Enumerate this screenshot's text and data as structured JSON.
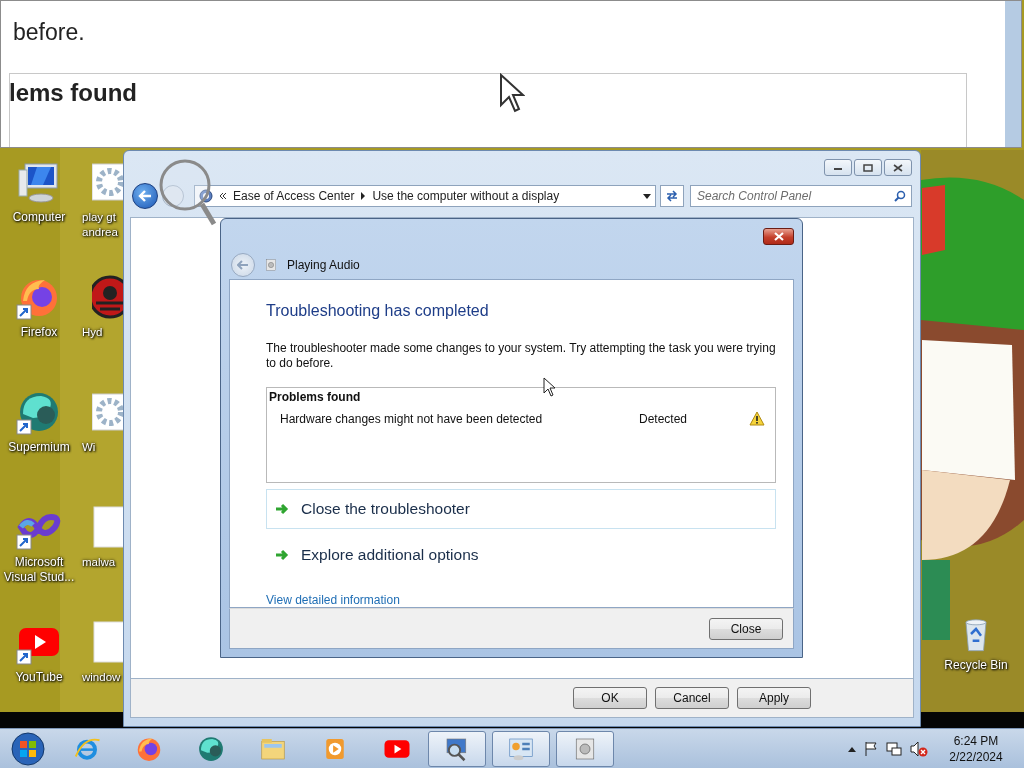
{
  "magnifier": {
    "texts": [
      "before.",
      "lems found"
    ]
  },
  "desktop_icons": [
    {
      "kind": "computer",
      "lines": [
        "Computer"
      ],
      "shortcut": false
    },
    {
      "kind": "firefox",
      "lines": [
        "Firefox"
      ],
      "shortcut": true
    },
    {
      "kind": "supermium",
      "lines": [
        "Supermium"
      ],
      "shortcut": true
    },
    {
      "kind": "visualstudio",
      "lines": [
        "Microsoft",
        "Visual Stud..."
      ],
      "shortcut": true
    },
    {
      "kind": "youtube",
      "lines": [
        "YouTube"
      ],
      "shortcut": true
    }
  ],
  "desktop_icons_2": [
    {
      "kind": "gear",
      "lines": [
        "play gt",
        "andrea"
      ]
    },
    {
      "kind": "emblem",
      "lines": [
        "Hyd"
      ]
    },
    {
      "kind": "gear",
      "lines": [
        "Wi"
      ]
    },
    {
      "kind": "document",
      "lines": [
        "malwa"
      ]
    },
    {
      "kind": "document",
      "lines": [
        "window"
      ]
    }
  ],
  "recycle_bin": {
    "label": "Recycle Bin"
  },
  "control_panel": {
    "breadcrumbs": [
      "Ease of Access Center",
      "Use the computer without a display"
    ],
    "search": {
      "placeholder": "Search Control Panel"
    },
    "buttons": [
      "OK",
      "Cancel",
      "Apply"
    ]
  },
  "troubleshooter": {
    "title": "Playing Audio",
    "heading": "Troubleshooting has completed",
    "message": "The troubleshooter made some changes to your system. Try attempting the task you were trying to do before.",
    "problems": {
      "title": "Problems found",
      "rows": [
        {
          "problem": "Hardware changes might not have been detected",
          "status": "Detected",
          "kind": "warning"
        }
      ]
    },
    "options": [
      {
        "label": "Close the troubleshooter",
        "selected": true
      },
      {
        "label": "Explore additional options",
        "selected": false
      }
    ],
    "link": "View detailed information",
    "close_button": "Close"
  },
  "taskbar": {
    "pinned": [
      {
        "kind": "ie"
      },
      {
        "kind": "firefox"
      },
      {
        "kind": "supermium"
      },
      {
        "kind": "explorer"
      },
      {
        "kind": "media"
      },
      {
        "kind": "youtube"
      }
    ],
    "running": [
      {
        "kind": "magnifier"
      },
      {
        "kind": "control-panel"
      },
      {
        "kind": "troubleshooter"
      }
    ],
    "clock": {
      "time": "6:24 PM",
      "date": "2/22/2024"
    }
  }
}
